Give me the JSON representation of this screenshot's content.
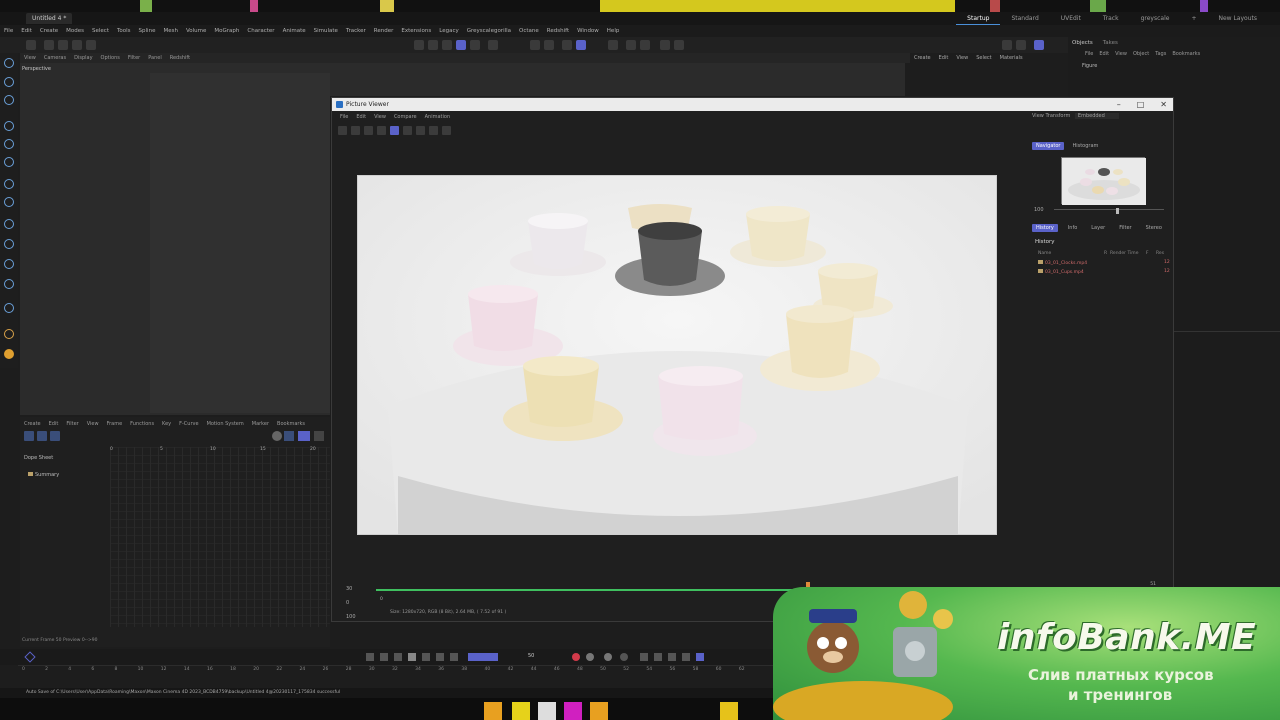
{
  "app": {
    "doc_tab": "Untitled 4 *",
    "layouts": [
      "Startup",
      "Standard",
      "UVEdit",
      "Track",
      "greyscale",
      "+",
      "New Layouts"
    ],
    "active_layout": "Startup"
  },
  "menubar": [
    "File",
    "Edit",
    "Create",
    "Modes",
    "Select",
    "Tools",
    "Spline",
    "Mesh",
    "Volume",
    "MoGraph",
    "Character",
    "Animate",
    "Simulate",
    "Tracker",
    "Render",
    "Extensions",
    "Legacy",
    "Greyscalegorilla",
    "Octane",
    "Redshift",
    "Window",
    "Help"
  ],
  "viewport": {
    "menu": [
      "View",
      "Cameras",
      "Display",
      "Options",
      "Filter",
      "Panel",
      "Redshift"
    ],
    "label": "Perspective"
  },
  "viewport2": {
    "menu": [
      "Create",
      "Edit",
      "View",
      "Select",
      "Materials"
    ]
  },
  "timeline": {
    "menu": [
      "Create",
      "Edit",
      "Filter",
      "View",
      "Frame",
      "Functions",
      "Key",
      "F-Curve",
      "Motion System",
      "Marker",
      "Bookmarks"
    ],
    "dope_sheet": "Dope Sheet",
    "summary": "Summary",
    "ruler": [
      "0",
      "5",
      "10",
      "15",
      "20"
    ]
  },
  "objects_panel": {
    "tabs": [
      "Objects",
      "Takes"
    ],
    "menu": [
      "File",
      "Edit",
      "View",
      "Object",
      "Tags",
      "Bookmarks"
    ],
    "figure": "Figure"
  },
  "picture_viewer": {
    "title": "Picture Viewer",
    "win_buttons": [
      "–",
      "□",
      "✕"
    ],
    "menu": [
      "File",
      "Edit",
      "View",
      "Compare",
      "Animation"
    ],
    "view_transform_label": "View Transform",
    "view_transform_value": "Embedded",
    "nav_tabs": [
      "Navigator",
      "Histogram"
    ],
    "zoom": "100",
    "hist_tabs": [
      "History",
      "Info",
      "Layer",
      "Filter",
      "Stereo"
    ],
    "history_label": "History",
    "history_cols": [
      "Name",
      "R",
      "Render Time",
      "F",
      "Res"
    ],
    "history_rows": [
      {
        "name": "03_01_Clocks.mp4",
        "res": "12"
      },
      {
        "name": "03_01_Cups.mp4",
        "res": "12"
      }
    ],
    "frame_labels": [
      "30",
      "0",
      "100"
    ],
    "size_info": "Size: 1280x720, RGB (8 Bit), 2.64 MB,  ( 7.52 of 91 )",
    "ruler_end": "51",
    "ruler_start_value": "0"
  },
  "status": {
    "current_frame": "Current Frame  50  Preview  0-->90",
    "path": "Auto Save of C:\\Users\\User\\AppData\\Roaming\\Maxon\\Maxon Cinema 4D 2023_BCDB4759\\backup\\Untitled 4@20230117_175834 successful",
    "frame_field": "50"
  },
  "bottom_ruler": [
    "0",
    "2",
    "4",
    "6",
    "8",
    "10",
    "12",
    "14",
    "16",
    "18",
    "20",
    "22",
    "24",
    "26",
    "28",
    "30",
    "32",
    "34",
    "36",
    "38",
    "40",
    "42",
    "44",
    "46",
    "48",
    "50",
    "52",
    "54",
    "56",
    "58",
    "60",
    "62"
  ],
  "ad": {
    "brand": "infoBank.ME",
    "line1": "Слив платных курсов",
    "line2": "и тренингов"
  },
  "colors": {
    "accent": "#5a62c9",
    "progress": "#3fbf5f",
    "ad_green": "#55b84f"
  }
}
